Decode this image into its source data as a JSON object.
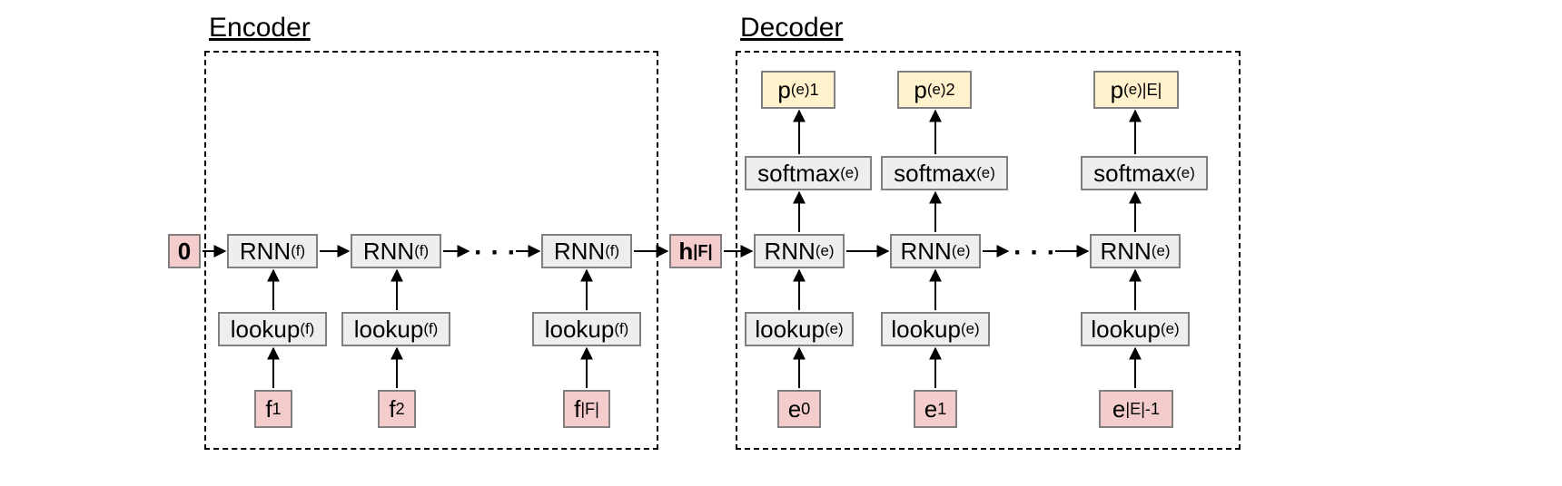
{
  "titles": {
    "encoder": "Encoder",
    "decoder": "Decoder"
  },
  "init": {
    "zero": "0",
    "h": {
      "base": "h",
      "sub": "|F|"
    }
  },
  "encoder": {
    "rnn": {
      "base": "RNN",
      "sup": "(f)"
    },
    "lookup": {
      "base": "lookup",
      "sup": "(f)"
    },
    "inputs": [
      {
        "base": "f",
        "sub": "1"
      },
      {
        "base": "f",
        "sub": "2"
      },
      {
        "base": "f",
        "sub": "|F|"
      }
    ]
  },
  "decoder": {
    "rnn": {
      "base": "RNN",
      "sup": "(e)"
    },
    "lookup": {
      "base": "lookup",
      "sup": "(e)"
    },
    "softmax": {
      "base": "softmax",
      "sup": "(e)"
    },
    "p": {
      "base": "p",
      "sup": "(e)"
    },
    "p_subs": [
      "1",
      "2",
      "|E|"
    ],
    "inputs": [
      {
        "base": "e",
        "sub": "0"
      },
      {
        "base": "e",
        "sub": "1"
      },
      {
        "base": "e",
        "sub": "|E|-1"
      }
    ]
  },
  "ellipsis": "· · ·"
}
